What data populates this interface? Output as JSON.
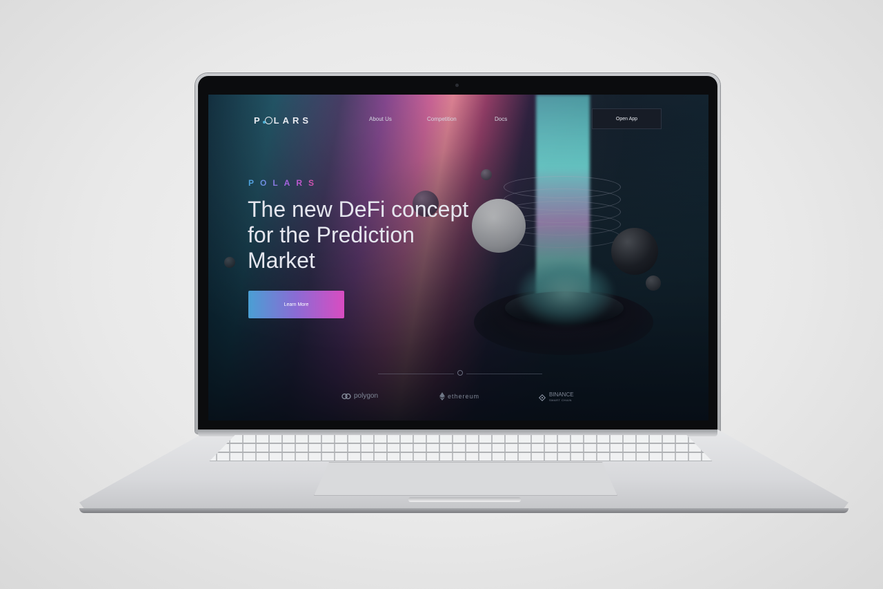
{
  "nav": {
    "logo_text": "POLARS",
    "links": [
      "About Us",
      "Competition",
      "Docs"
    ],
    "open_app_label": "Open App"
  },
  "hero": {
    "kicker": "POLARS",
    "headline": "The new DeFi concept for the Prediction Market",
    "cta_label": "Learn More"
  },
  "partners": [
    {
      "name": "polygon",
      "icon": "polygon-icon"
    },
    {
      "name": "ethereum",
      "icon": "ethereum-icon"
    },
    {
      "name": "BINANCE",
      "subtext": "SMART CHAIN",
      "icon": "binance-icon"
    }
  ],
  "colors": {
    "cta_gradient_start": "#4a9fd4",
    "cta_gradient_end": "#d94cc1",
    "beam": "#76e8e4"
  }
}
